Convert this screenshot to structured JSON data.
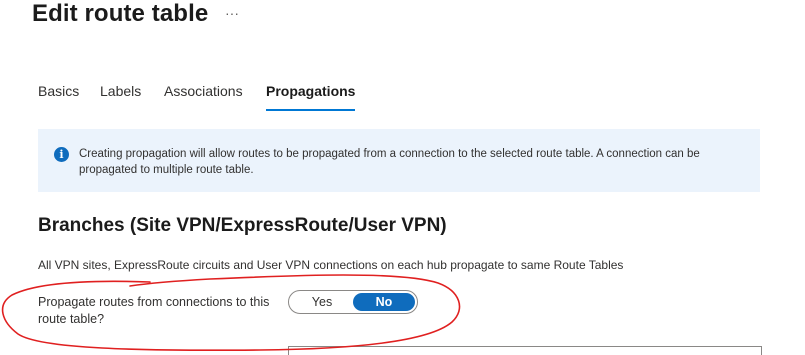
{
  "header": {
    "title": "Edit route table",
    "more_label": "···"
  },
  "tabs": [
    {
      "label": "Basics",
      "active": false
    },
    {
      "label": "Labels",
      "active": false
    },
    {
      "label": "Associations",
      "active": false
    },
    {
      "label": "Propagations",
      "active": true
    }
  ],
  "info_banner": {
    "icon": "info-icon",
    "icon_glyph": "i",
    "text": "Creating propagation will allow routes to be propagated from a connection to the selected route table. A connection can be propagated to multiple route table."
  },
  "branches": {
    "title": "Branches (Site VPN/ExpressRoute/User VPN)",
    "description": "All VPN sites, ExpressRoute circuits and User VPN connections on each hub propagate to same Route Tables",
    "propagate_field": {
      "label": "Propagate routes from connections to this route table?",
      "options": [
        "Yes",
        "No"
      ],
      "selected": "No"
    }
  },
  "colors": {
    "accent": "#0f6cbd",
    "tab_underline": "#0078d4",
    "banner_background": "#ebf3fc",
    "annotation": "#e02020"
  }
}
